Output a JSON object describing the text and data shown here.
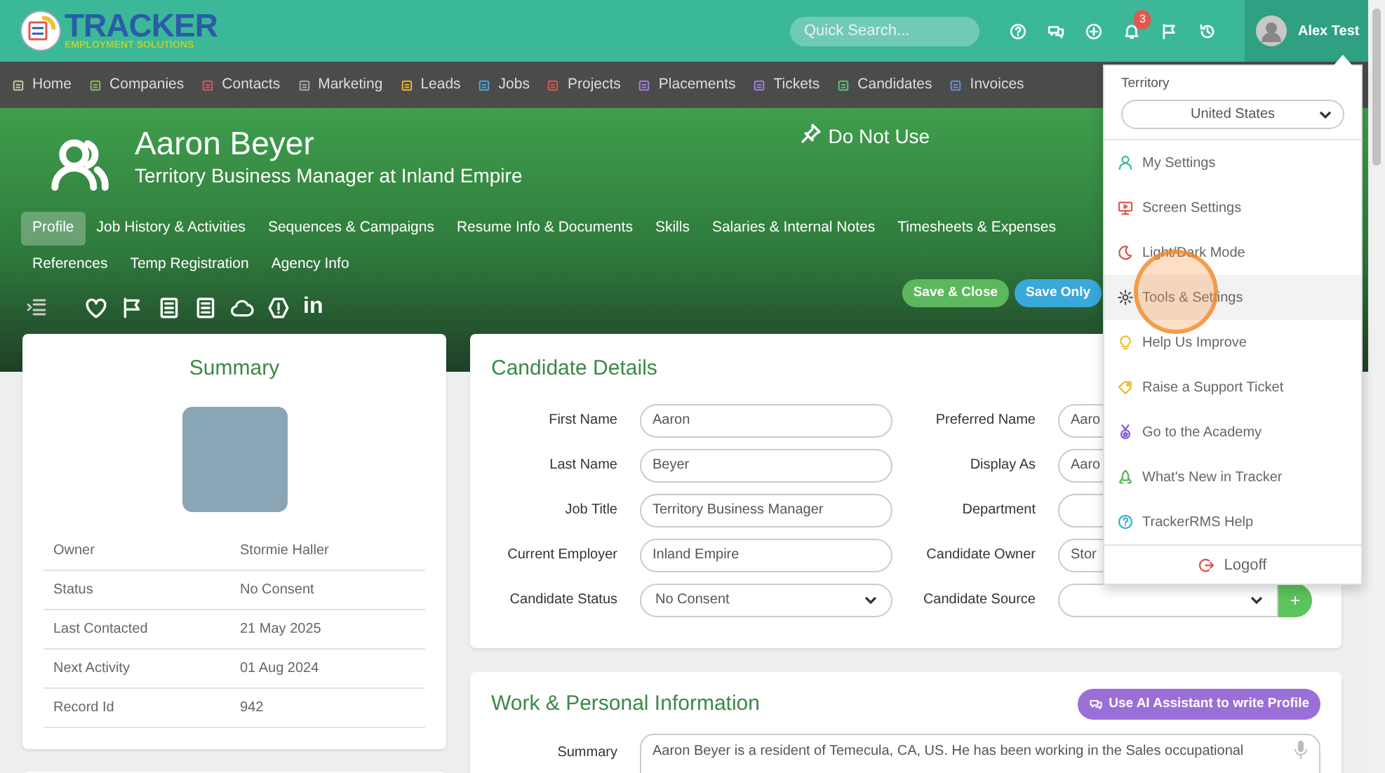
{
  "brand": {
    "name": "TRACKER",
    "tagline": "EMPLOYMENT SOLUTIONS"
  },
  "search": {
    "placeholder": "Quick Search..."
  },
  "notifications": {
    "count": "3"
  },
  "user": {
    "name": "Alex Test"
  },
  "nav": [
    {
      "label": "Home",
      "color": "#c9c9a0"
    },
    {
      "label": "Companies",
      "color": "#7fc35a"
    },
    {
      "label": "Contacts",
      "color": "#e0584f"
    },
    {
      "label": "Marketing",
      "color": "#aaaaaa"
    },
    {
      "label": "Leads",
      "color": "#f0b429"
    },
    {
      "label": "Jobs",
      "color": "#4aa8e0"
    },
    {
      "label": "Projects",
      "color": "#e0584f"
    },
    {
      "label": "Placements",
      "color": "#a77ee0"
    },
    {
      "label": "Tickets",
      "color": "#a77ee0"
    },
    {
      "label": "Candidates",
      "color": "#5cc47a"
    },
    {
      "label": "Invoices",
      "color": "#6a8ee0"
    }
  ],
  "profile": {
    "name": "Aaron Beyer",
    "subtitle": "Territory Business Manager at Inland Empire",
    "flag": "Do Not Use"
  },
  "tabs": [
    {
      "label": "Profile",
      "selected": true
    },
    {
      "label": "Job History & Activities",
      "selected": false
    },
    {
      "label": "Sequences & Campaigns",
      "selected": false
    },
    {
      "label": "Resume Info & Documents",
      "selected": false
    },
    {
      "label": "Skills",
      "selected": false
    },
    {
      "label": "Salaries & Internal Notes",
      "selected": false
    },
    {
      "label": "Timesheets & Expenses",
      "selected": false
    },
    {
      "label": "References",
      "selected": false
    },
    {
      "label": "Temp Registration",
      "selected": false
    },
    {
      "label": "Agency Info",
      "selected": false
    }
  ],
  "toolbar": {
    "linkedin_label": "in"
  },
  "actions": [
    {
      "label": "Save & Close",
      "kind": "success"
    },
    {
      "label": "Save Only",
      "kind": "info"
    }
  ],
  "summary": {
    "title": "Summary",
    "rows": [
      {
        "label": "Owner",
        "value": "Stormie Haller"
      },
      {
        "label": "Status",
        "value": "No Consent"
      },
      {
        "label": "Last Contacted",
        "value": "21 May 2025"
      },
      {
        "label": "Next Activity",
        "value": "01 Aug 2024"
      },
      {
        "label": "Record Id",
        "value": "942"
      }
    ]
  },
  "details": {
    "title": "Candidate Details",
    "fields": [
      {
        "label": "First Name",
        "value": "Aaron",
        "kind": "text"
      },
      {
        "label": "Preferred Name",
        "value": "Aaro",
        "kind": "text"
      },
      {
        "label": "Last Name",
        "value": "Beyer",
        "kind": "text"
      },
      {
        "label": "Display As",
        "value": "Aaro",
        "kind": "text"
      },
      {
        "label": "Job Title",
        "value": "Territory Business Manager",
        "kind": "text"
      },
      {
        "label": "Department",
        "kind": "text"
      },
      {
        "label": "Current Employer",
        "value": "Inland Empire",
        "kind": "text"
      },
      {
        "label": "Candidate Owner",
        "value": "Stor",
        "kind": "text"
      },
      {
        "label": "Candidate Status",
        "value": "No Consent",
        "kind": "select"
      },
      {
        "label": "Candidate Source",
        "kind": "select-add",
        "add_label": "+"
      }
    ]
  },
  "work": {
    "title": "Work & Personal Information",
    "ai_button": "Use AI Assistant to write Profile",
    "summary_label": "Summary",
    "summary_text": "Aaron Beyer is a resident of Temecula, CA, US. He has been working in the Sales occupational"
  },
  "menu": {
    "territory_label": "Territory",
    "territory_value": "United States",
    "items": [
      {
        "label": "My Settings",
        "color": "#3bb89a",
        "selected": false
      },
      {
        "label": "Screen Settings",
        "color": "#e0584f",
        "selected": false
      },
      {
        "label": "Light/Dark Mode",
        "color": "#d9534f",
        "selected": false
      },
      {
        "label": "Tools & Settings",
        "color": "#555555",
        "selected": true
      },
      {
        "label": "Help Us Improve",
        "color": "#f0c030",
        "selected": false
      },
      {
        "label": "Raise a Support Ticket",
        "color": "#e8b830",
        "selected": false
      },
      {
        "label": "Go to the Academy",
        "color": "#8a5cd0",
        "selected": false
      },
      {
        "label": "What's New in Tracker",
        "color": "#5cb85c",
        "selected": false
      },
      {
        "label": "TrackerRMS Help",
        "color": "#3ab0d0",
        "selected": false
      }
    ],
    "logoff": "Logoff"
  }
}
